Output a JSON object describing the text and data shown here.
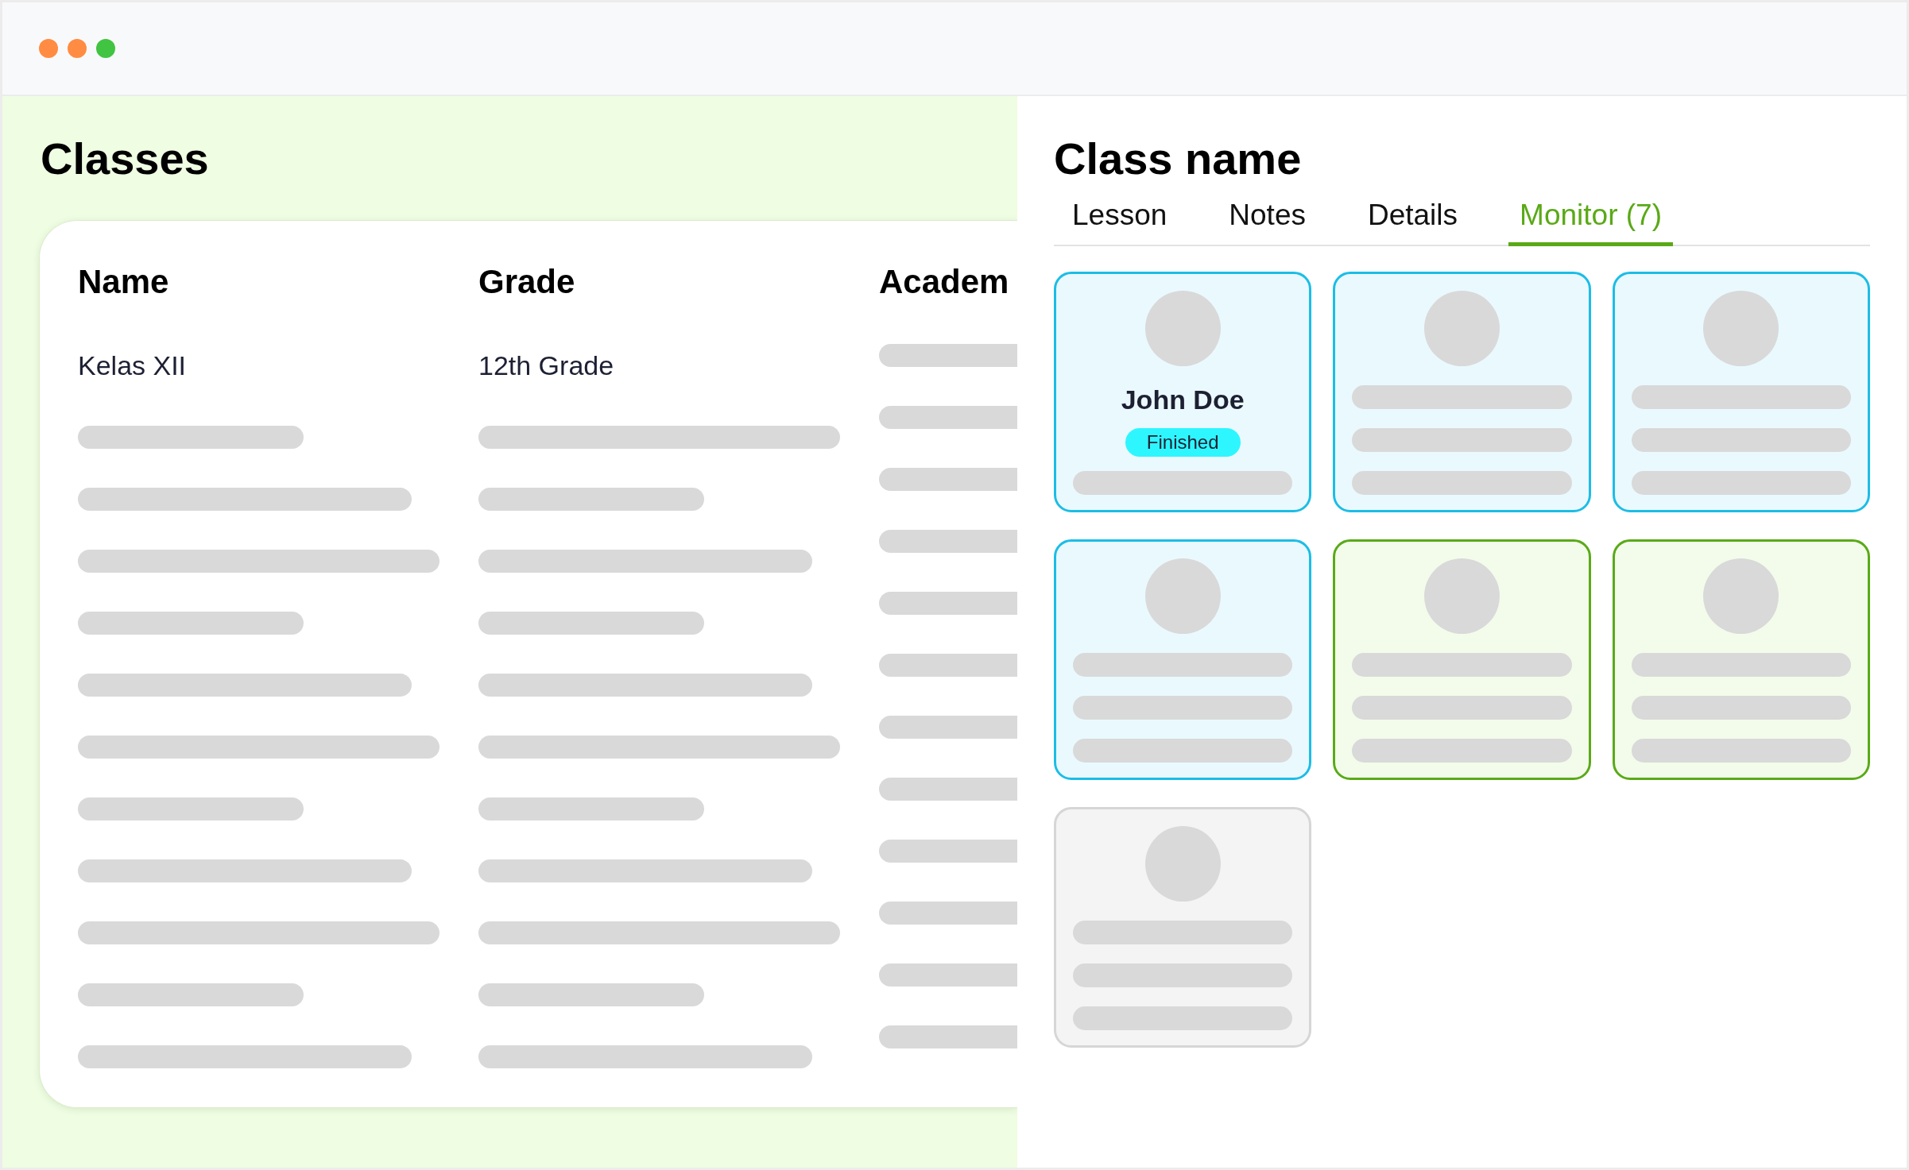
{
  "window": {
    "controls": [
      {
        "color": "#ff8c42"
      },
      {
        "color": "#ff8c42"
      },
      {
        "color": "#41c441"
      }
    ]
  },
  "classes_panel": {
    "title": "Classes",
    "table": {
      "columns": [
        "Name",
        "Grade",
        "Academ"
      ],
      "rows": [
        [
          "Kelas XII",
          "12th Grade"
        ]
      ]
    }
  },
  "class_panel": {
    "title": "Class name",
    "tabs": [
      {
        "label": "Lesson",
        "selected": false
      },
      {
        "label": "Notes",
        "selected": false
      },
      {
        "label": "Details",
        "selected": false
      },
      {
        "label": "Monitor (7)",
        "selected": true
      }
    ],
    "students": [
      {
        "kind": "named",
        "name": "John Doe",
        "status": "Finished",
        "color": "#1cbde6"
      },
      {
        "kind": "placeholder",
        "color": "#1cbde6"
      },
      {
        "kind": "placeholder",
        "color": "#1cbde6"
      },
      {
        "kind": "placeholder",
        "color": "#1cbde6"
      },
      {
        "kind": "placeholder",
        "color": "#5aaa18"
      },
      {
        "kind": "placeholder",
        "color": "#5aaa18"
      },
      {
        "kind": "placeholder",
        "color": "#d6d6d6"
      }
    ]
  }
}
